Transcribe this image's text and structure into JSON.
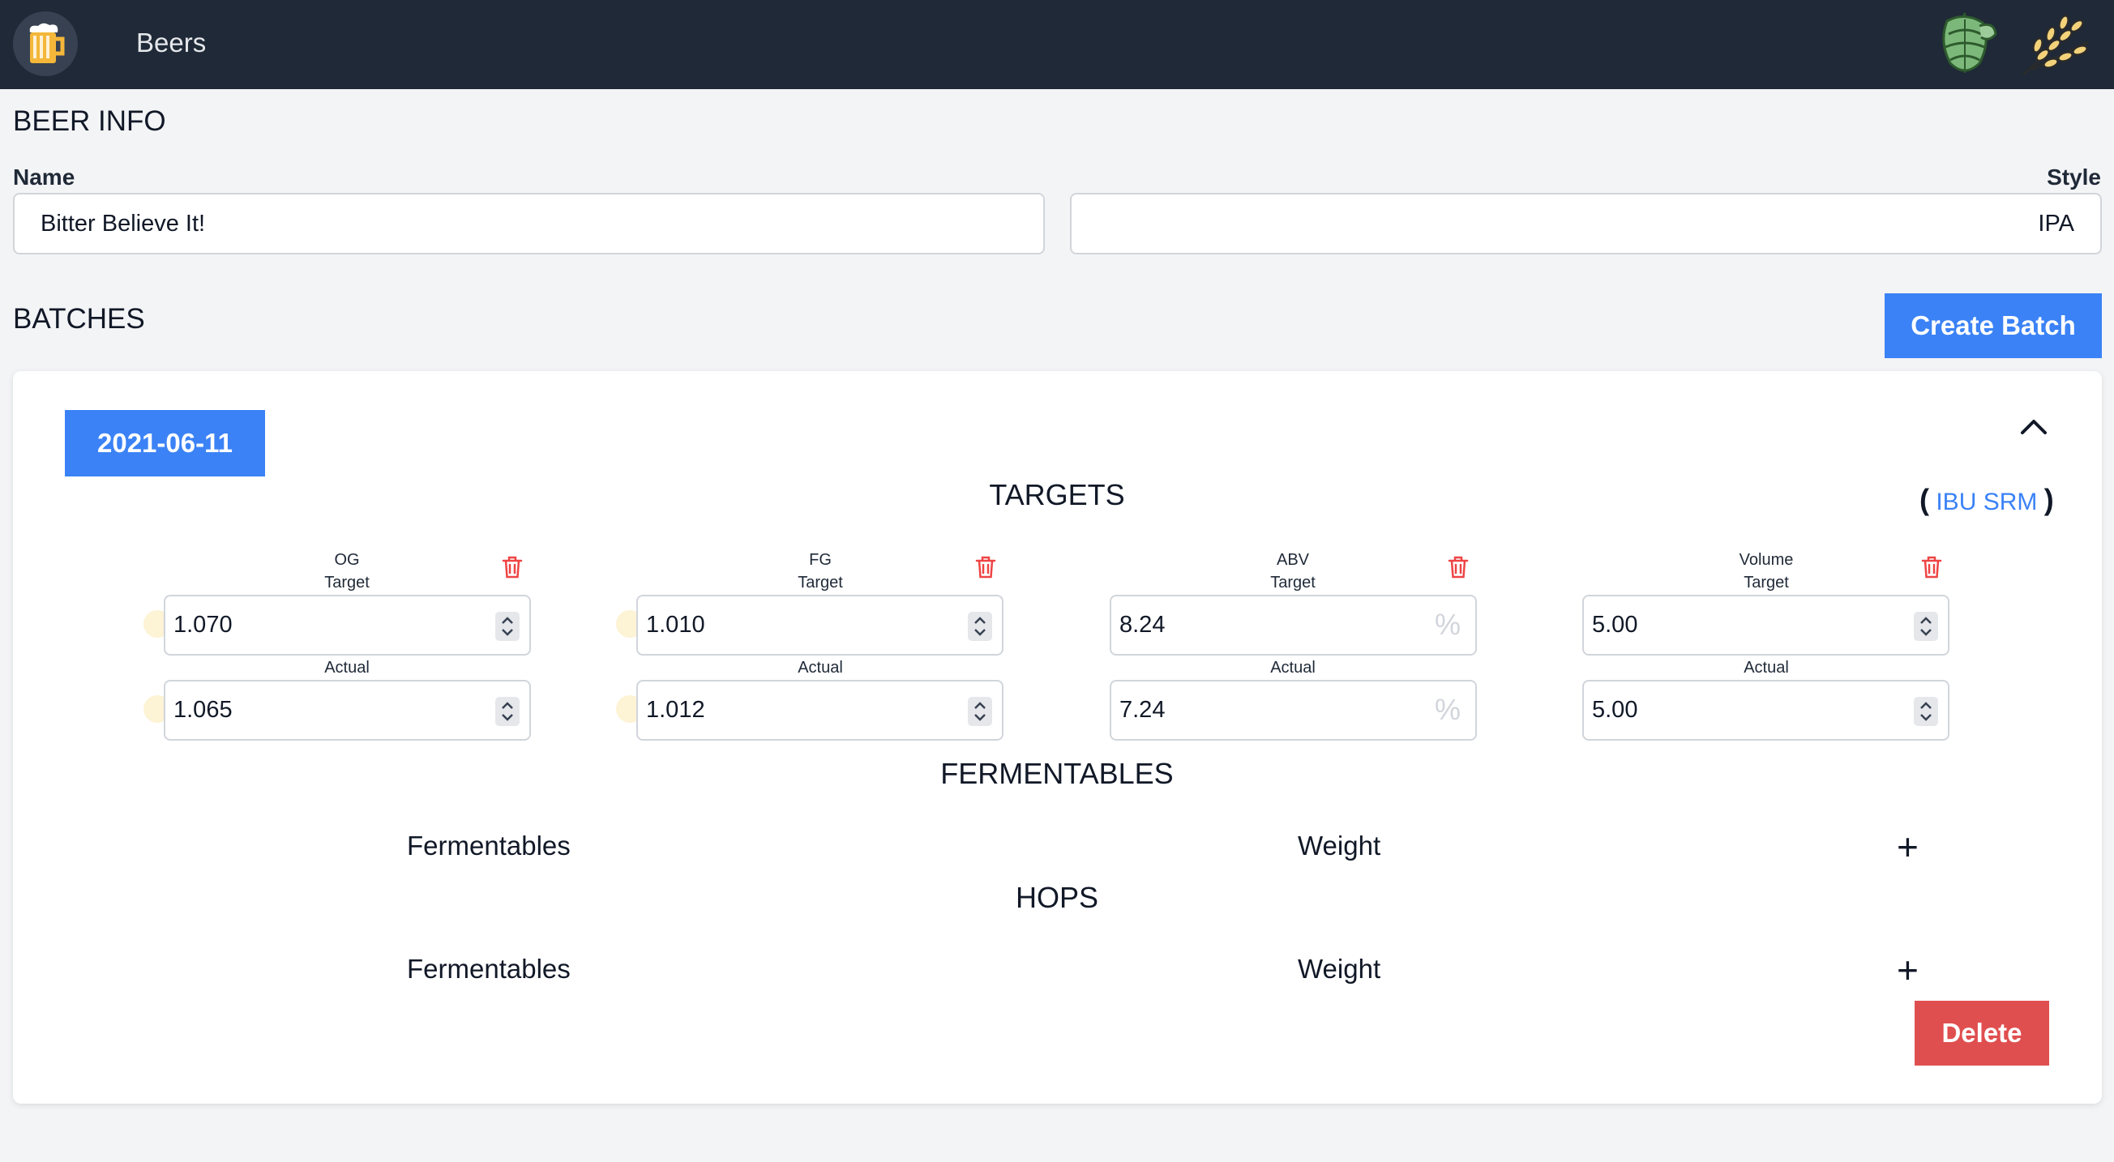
{
  "navbar": {
    "title": "Beers",
    "logo_icon": "beer-mug-icon",
    "hop_icon": "hop-icon",
    "grain_icon": "wheat-grain-icon"
  },
  "beer_info": {
    "heading": "BEER INFO",
    "name_label": "Name",
    "name_value": "Bitter Believe It!",
    "style_label": "Style",
    "style_value": "IPA"
  },
  "batches": {
    "heading": "BATCHES",
    "create_label": "Create Batch",
    "batch": {
      "date": "2021-06-11",
      "targets_heading": "TARGETS",
      "units_open": "(",
      "units_ibu": "IBU",
      "units_srm": "SRM",
      "units_close": ")",
      "metrics": [
        {
          "name": "OG",
          "target_label": "Target",
          "actual_label": "Actual",
          "target": "1.070",
          "actual": "1.065"
        },
        {
          "name": "FG",
          "target_label": "Target",
          "actual_label": "Actual",
          "target": "1.010",
          "actual": "1.012"
        },
        {
          "name": "ABV",
          "target_label": "Target",
          "actual_label": "Actual",
          "target": "8.24",
          "actual": "7.24",
          "unit": "%"
        },
        {
          "name": "Volume",
          "target_label": "Target",
          "actual_label": "Actual",
          "target": "5.00",
          "actual": "5.00"
        }
      ],
      "fermentables": {
        "heading": "FERMENTABLES",
        "col1": "Fermentables",
        "col2": "Weight",
        "add": "+"
      },
      "hops": {
        "heading": "HOPS",
        "col1": "Fermentables",
        "col2": "Weight",
        "add": "+"
      },
      "delete_label": "Delete"
    }
  },
  "colors": {
    "navbar": "#1f2937",
    "primary": "#3b82f6",
    "danger": "#e04f4f",
    "background": "#f3f4f6"
  }
}
